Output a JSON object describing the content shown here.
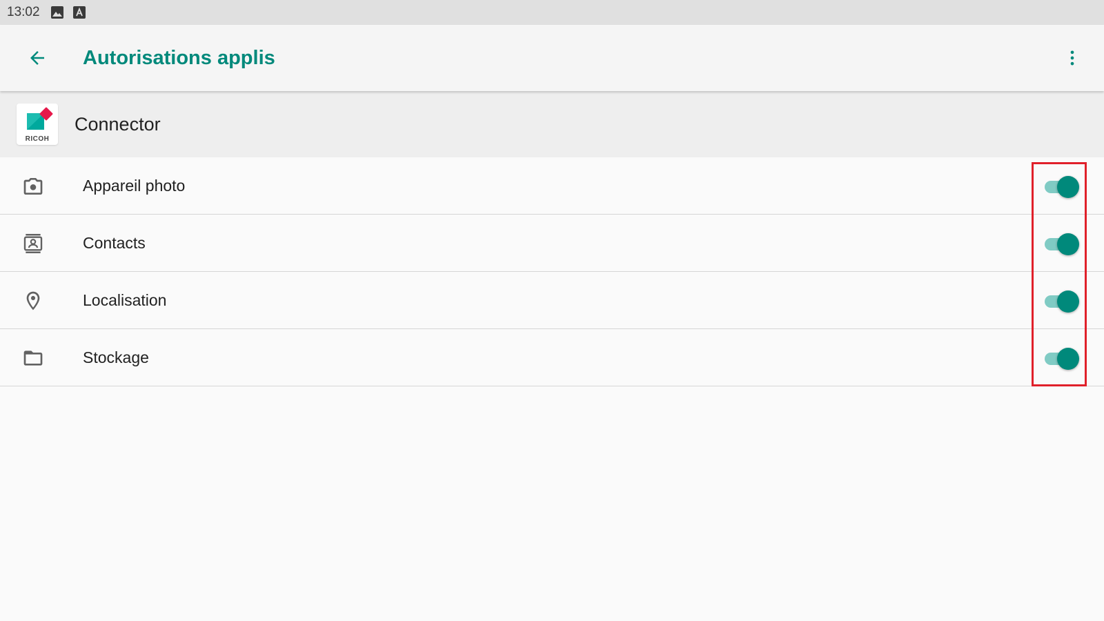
{
  "status_bar": {
    "time": "13:02",
    "icons": [
      "image-icon",
      "keyboard-a-icon"
    ]
  },
  "app_bar": {
    "title": "Autorisations applis",
    "back_icon": "arrow-back-icon",
    "menu_icon": "more-vert-icon"
  },
  "app": {
    "name": "Connector",
    "logo_text": "RICOH"
  },
  "permissions": [
    {
      "label": "Appareil photo",
      "icon": "camera-icon",
      "enabled": true
    },
    {
      "label": "Contacts",
      "icon": "contacts-icon",
      "enabled": true
    },
    {
      "label": "Localisation",
      "icon": "location-pin-icon",
      "enabled": true
    },
    {
      "label": "Stockage",
      "icon": "folder-icon",
      "enabled": true
    }
  ],
  "colors": {
    "accent": "#00897b",
    "switch_track": "#80cbc4",
    "highlight": "#e0202a",
    "status_bar": "#e0e0e0",
    "app_bar": "#f5f5f5"
  }
}
